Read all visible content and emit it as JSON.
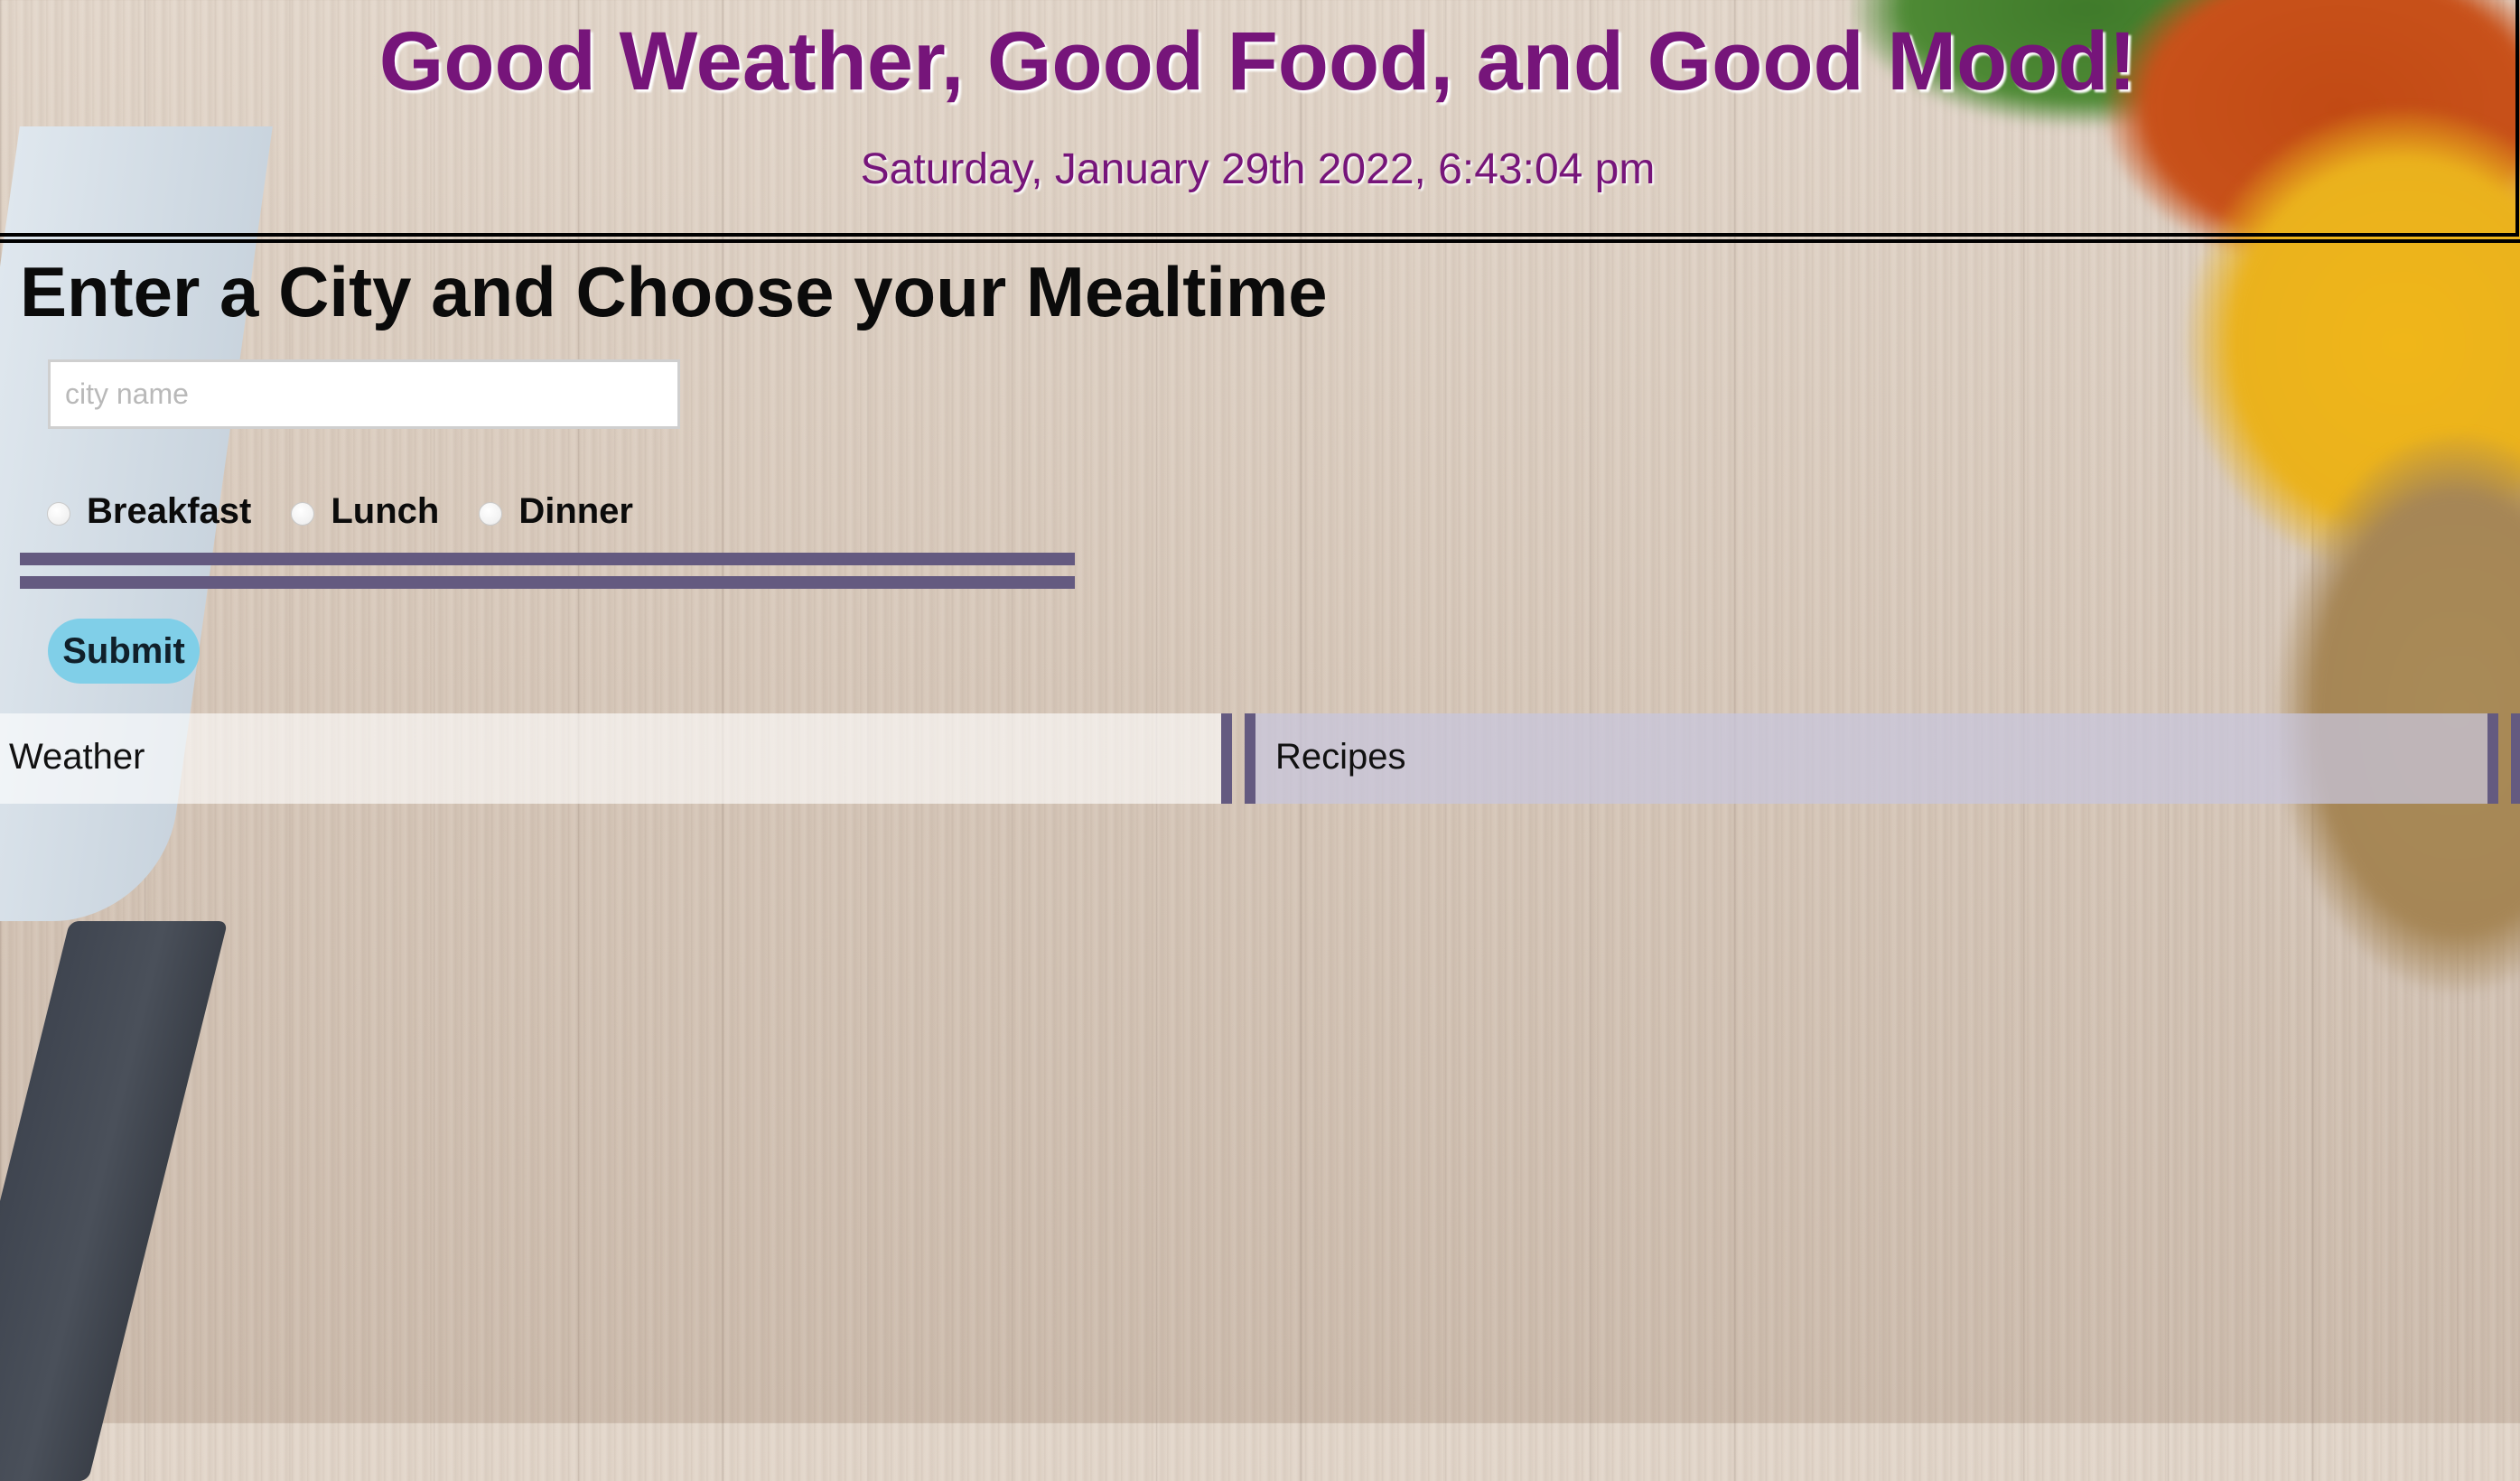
{
  "header": {
    "title": "Good Weather, Good Food, and Good Mood!",
    "datetime": "Saturday, January 29th 2022, 6:43:04 pm"
  },
  "form": {
    "heading": "Enter a City and Choose your Mealtime",
    "city_input": {
      "value": "",
      "placeholder": "city name"
    },
    "mealtime_options": [
      {
        "label": "Breakfast",
        "checked": false
      },
      {
        "label": "Lunch",
        "checked": false
      },
      {
        "label": "Dinner",
        "checked": false
      }
    ],
    "submit_label": "Submit"
  },
  "results": {
    "weather_label": "Weather",
    "recipes_label": "Recipes"
  },
  "colors": {
    "title_purple": "#76157a",
    "accent_bar": "#645a80",
    "submit_bg": "#80cfe8",
    "recipes_panel": "#c8c6de"
  }
}
